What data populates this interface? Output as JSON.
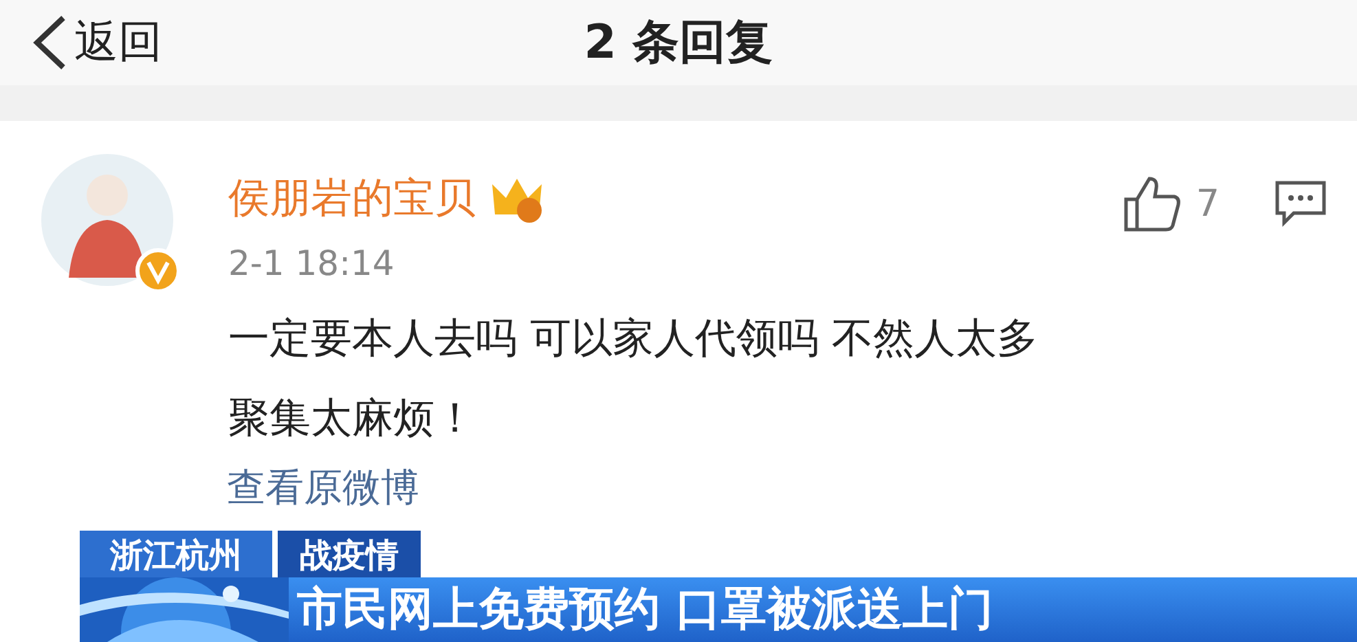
{
  "header": {
    "back_label": "返回",
    "title": "2 条回复"
  },
  "comment": {
    "author": "侯朋岩的宝贝",
    "verified": true,
    "time": "2-1 18:14",
    "likes": "7",
    "text": "一定要本人去吗 可以家人代领吗 不然人太多聚集太麻烦！"
  },
  "link": "查看原微博",
  "news_banner": {
    "location": "浙江杭州",
    "topic": "战疫情",
    "headline": "市民网上免费预约 口罩被派送上门"
  }
}
